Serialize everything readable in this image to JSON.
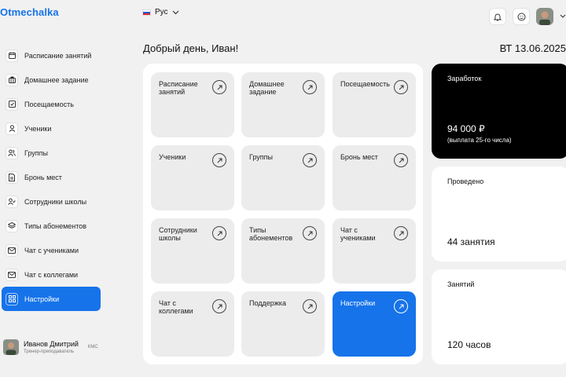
{
  "header": {
    "logo": "Otmechalka",
    "language": "Рус",
    "flag_colors": [
      "#ffffff",
      "#1c57d8",
      "#e02a2a"
    ]
  },
  "sidebar": {
    "items": [
      {
        "label": "Расписание занятий",
        "icon": "calendar-icon"
      },
      {
        "label": "Домашнее задание",
        "icon": "briefcase-icon"
      },
      {
        "label": "Посещаемость",
        "icon": "checkbox-icon"
      },
      {
        "label": "Ученики",
        "icon": "user-icon"
      },
      {
        "label": "Группы",
        "icon": "users-icon"
      },
      {
        "label": "Бронь мест",
        "icon": "document-icon"
      },
      {
        "label": "Сотрудники школы",
        "icon": "user-check-icon"
      },
      {
        "label": "Типы абонементов",
        "icon": "layers-icon"
      },
      {
        "label": "Чат с учениками",
        "icon": "mail-icon"
      },
      {
        "label": "Чат с коллегами",
        "icon": "mail-icon"
      },
      {
        "label": "Настройки",
        "icon": "grid-icon",
        "active": true
      }
    ]
  },
  "user": {
    "name": "Иванов Дмитрий",
    "role": "Тренер-преподаватель",
    "rank": "КМС"
  },
  "main": {
    "greeting": "Добрый день, Иван!",
    "date": "ВТ 13.06.2025",
    "tiles": [
      {
        "label": "Расписание занятий"
      },
      {
        "label": "Домашнее задание"
      },
      {
        "label": "Посещаемость"
      },
      {
        "label": "Ученики"
      },
      {
        "label": "Группы"
      },
      {
        "label": "Бронь мест"
      },
      {
        "label": "Сотрудники школы"
      },
      {
        "label": "Типы абонементов"
      },
      {
        "label": "Чат с учениками"
      },
      {
        "label": "Чат с коллегами"
      },
      {
        "label": "Поддержка"
      },
      {
        "label": "Настройки",
        "active": true
      }
    ]
  },
  "stats": {
    "earnings": {
      "title": "Заработок",
      "value": "94 000 ₽",
      "note": "(выплата 25-го числа)"
    },
    "conducted": {
      "title": "Проведено",
      "value": "44 занятия"
    },
    "lessons": {
      "title": "Занятий",
      "value": "120 часов"
    }
  },
  "colors": {
    "accent": "#1673ea",
    "dark_card": "#000000"
  }
}
